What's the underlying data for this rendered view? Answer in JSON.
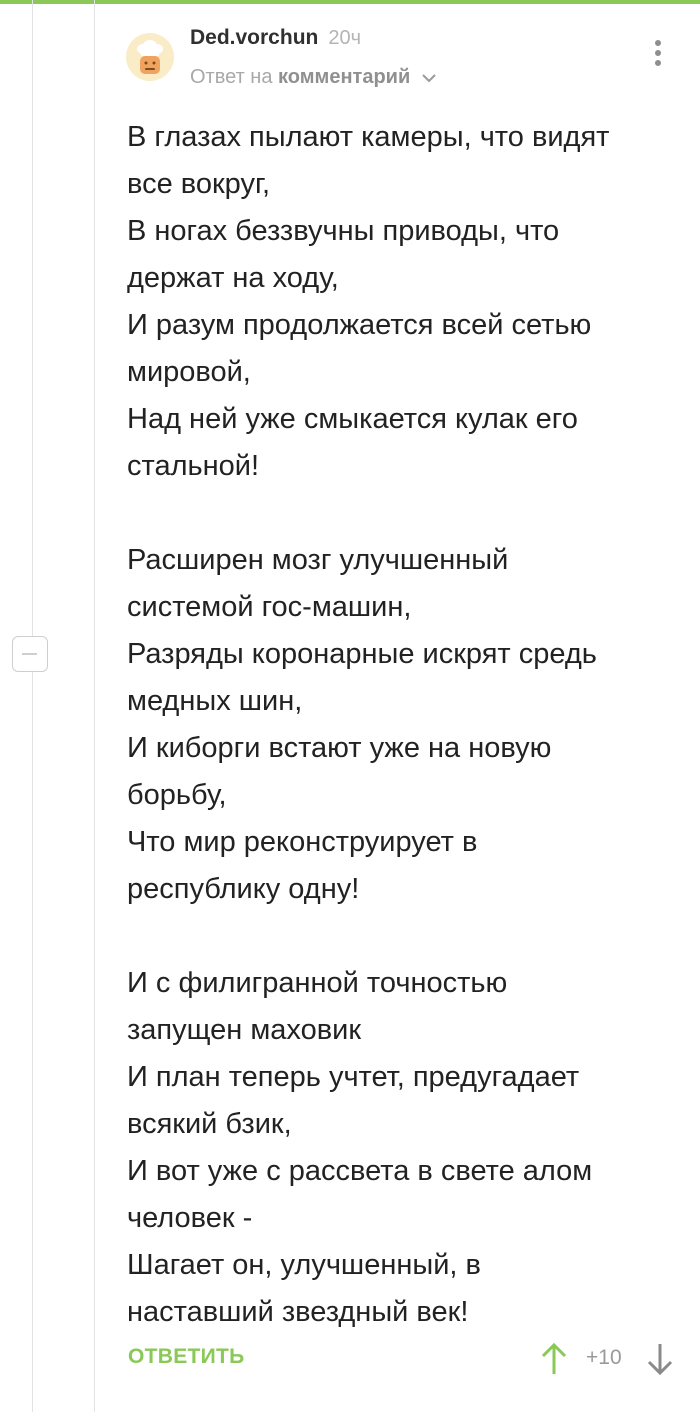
{
  "comment": {
    "author": "Ded.vorchun",
    "time": "20ч",
    "reply_prefix": "Ответ на",
    "reply_link": "комментарий",
    "lines": [
      "В глазах пылают камеры, что видят",
      "все вокруг,",
      "В ногах беззвучны приводы, что",
      "держат на ходу,",
      "И разум продолжается всей сетью",
      "мировой,",
      "Над ней уже смыкается кулак его",
      "стальной!",
      "",
      "Расширен мозг улучшенный",
      "системой гос-машин,",
      "Разряды коронарные искрят средь",
      "медных шин,",
      "И киборги встают уже на новую",
      "борьбу,",
      "Что мир реконструирует в",
      "республику одну!",
      "",
      "И с филигранной точностью",
      "запущен маховик",
      "И план теперь учтет, предугадает",
      "всякий бзик,",
      "И вот уже с рассвета в свете алом",
      "человек -",
      "Шагает он, улучшенный, в",
      "наставший звездный век!"
    ],
    "reply_button": "ОТВЕТИТЬ",
    "rating": "+10"
  },
  "colors": {
    "accent": "#8ac858",
    "text": "#222222",
    "muted": "#a8a8a8"
  },
  "icons": [
    "avatar",
    "chevron-down-icon",
    "more-vertical-icon",
    "arrow-up-icon",
    "arrow-down-icon",
    "collapse-icon"
  ]
}
